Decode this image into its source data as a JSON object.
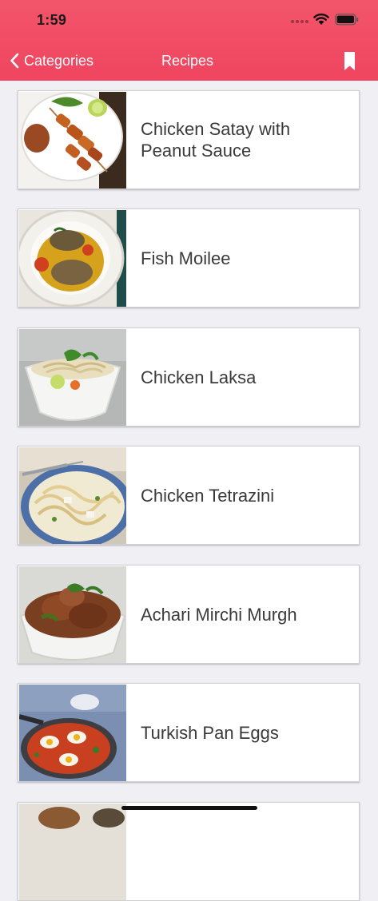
{
  "status_bar": {
    "time": "1:59"
  },
  "nav": {
    "back_label": "Categories",
    "title": "Recipes",
    "bookmark_icon": "bookmark-icon"
  },
  "recipes": [
    {
      "title": "Chicken Satay with Peanut Sauce",
      "image": "chicken-satay-photo"
    },
    {
      "title": "Fish Moilee",
      "image": "fish-moilee-photo"
    },
    {
      "title": "Chicken Laksa",
      "image": "chicken-laksa-photo"
    },
    {
      "title": "Chicken Tetrazini",
      "image": "chicken-tetrazini-photo"
    },
    {
      "title": "Achari Mirchi Murgh",
      "image": "achari-mirchi-murgh-photo"
    },
    {
      "title": "Turkish Pan Eggs",
      "image": "turkish-pan-eggs-photo"
    },
    {
      "title": "",
      "image": "partially-visible-recipe-photo"
    }
  ],
  "colors": {
    "header": "#f04560",
    "background": "#efeff4",
    "card": "#ffffff",
    "text": "#3a3a3a"
  }
}
